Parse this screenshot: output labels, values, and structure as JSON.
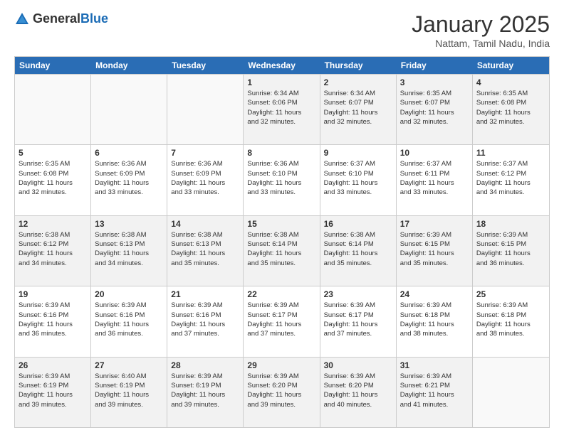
{
  "header": {
    "logo_general": "General",
    "logo_blue": "Blue",
    "month_title": "January 2025",
    "subtitle": "Nattam, Tamil Nadu, India"
  },
  "days_of_week": [
    "Sunday",
    "Monday",
    "Tuesday",
    "Wednesday",
    "Thursday",
    "Friday",
    "Saturday"
  ],
  "weeks": [
    [
      {
        "day": "",
        "info": ""
      },
      {
        "day": "",
        "info": ""
      },
      {
        "day": "",
        "info": ""
      },
      {
        "day": "1",
        "info": "Sunrise: 6:34 AM\nSunset: 6:06 PM\nDaylight: 11 hours\nand 32 minutes."
      },
      {
        "day": "2",
        "info": "Sunrise: 6:34 AM\nSunset: 6:07 PM\nDaylight: 11 hours\nand 32 minutes."
      },
      {
        "day": "3",
        "info": "Sunrise: 6:35 AM\nSunset: 6:07 PM\nDaylight: 11 hours\nand 32 minutes."
      },
      {
        "day": "4",
        "info": "Sunrise: 6:35 AM\nSunset: 6:08 PM\nDaylight: 11 hours\nand 32 minutes."
      }
    ],
    [
      {
        "day": "5",
        "info": "Sunrise: 6:35 AM\nSunset: 6:08 PM\nDaylight: 11 hours\nand 32 minutes."
      },
      {
        "day": "6",
        "info": "Sunrise: 6:36 AM\nSunset: 6:09 PM\nDaylight: 11 hours\nand 33 minutes."
      },
      {
        "day": "7",
        "info": "Sunrise: 6:36 AM\nSunset: 6:09 PM\nDaylight: 11 hours\nand 33 minutes."
      },
      {
        "day": "8",
        "info": "Sunrise: 6:36 AM\nSunset: 6:10 PM\nDaylight: 11 hours\nand 33 minutes."
      },
      {
        "day": "9",
        "info": "Sunrise: 6:37 AM\nSunset: 6:10 PM\nDaylight: 11 hours\nand 33 minutes."
      },
      {
        "day": "10",
        "info": "Sunrise: 6:37 AM\nSunset: 6:11 PM\nDaylight: 11 hours\nand 33 minutes."
      },
      {
        "day": "11",
        "info": "Sunrise: 6:37 AM\nSunset: 6:12 PM\nDaylight: 11 hours\nand 34 minutes."
      }
    ],
    [
      {
        "day": "12",
        "info": "Sunrise: 6:38 AM\nSunset: 6:12 PM\nDaylight: 11 hours\nand 34 minutes."
      },
      {
        "day": "13",
        "info": "Sunrise: 6:38 AM\nSunset: 6:13 PM\nDaylight: 11 hours\nand 34 minutes."
      },
      {
        "day": "14",
        "info": "Sunrise: 6:38 AM\nSunset: 6:13 PM\nDaylight: 11 hours\nand 35 minutes."
      },
      {
        "day": "15",
        "info": "Sunrise: 6:38 AM\nSunset: 6:14 PM\nDaylight: 11 hours\nand 35 minutes."
      },
      {
        "day": "16",
        "info": "Sunrise: 6:38 AM\nSunset: 6:14 PM\nDaylight: 11 hours\nand 35 minutes."
      },
      {
        "day": "17",
        "info": "Sunrise: 6:39 AM\nSunset: 6:15 PM\nDaylight: 11 hours\nand 35 minutes."
      },
      {
        "day": "18",
        "info": "Sunrise: 6:39 AM\nSunset: 6:15 PM\nDaylight: 11 hours\nand 36 minutes."
      }
    ],
    [
      {
        "day": "19",
        "info": "Sunrise: 6:39 AM\nSunset: 6:16 PM\nDaylight: 11 hours\nand 36 minutes."
      },
      {
        "day": "20",
        "info": "Sunrise: 6:39 AM\nSunset: 6:16 PM\nDaylight: 11 hours\nand 36 minutes."
      },
      {
        "day": "21",
        "info": "Sunrise: 6:39 AM\nSunset: 6:16 PM\nDaylight: 11 hours\nand 37 minutes."
      },
      {
        "day": "22",
        "info": "Sunrise: 6:39 AM\nSunset: 6:17 PM\nDaylight: 11 hours\nand 37 minutes."
      },
      {
        "day": "23",
        "info": "Sunrise: 6:39 AM\nSunset: 6:17 PM\nDaylight: 11 hours\nand 37 minutes."
      },
      {
        "day": "24",
        "info": "Sunrise: 6:39 AM\nSunset: 6:18 PM\nDaylight: 11 hours\nand 38 minutes."
      },
      {
        "day": "25",
        "info": "Sunrise: 6:39 AM\nSunset: 6:18 PM\nDaylight: 11 hours\nand 38 minutes."
      }
    ],
    [
      {
        "day": "26",
        "info": "Sunrise: 6:39 AM\nSunset: 6:19 PM\nDaylight: 11 hours\nand 39 minutes."
      },
      {
        "day": "27",
        "info": "Sunrise: 6:40 AM\nSunset: 6:19 PM\nDaylight: 11 hours\nand 39 minutes."
      },
      {
        "day": "28",
        "info": "Sunrise: 6:39 AM\nSunset: 6:19 PM\nDaylight: 11 hours\nand 39 minutes."
      },
      {
        "day": "29",
        "info": "Sunrise: 6:39 AM\nSunset: 6:20 PM\nDaylight: 11 hours\nand 39 minutes."
      },
      {
        "day": "30",
        "info": "Sunrise: 6:39 AM\nSunset: 6:20 PM\nDaylight: 11 hours\nand 40 minutes."
      },
      {
        "day": "31",
        "info": "Sunrise: 6:39 AM\nSunset: 6:21 PM\nDaylight: 11 hours\nand 41 minutes."
      },
      {
        "day": "",
        "info": ""
      }
    ]
  ]
}
